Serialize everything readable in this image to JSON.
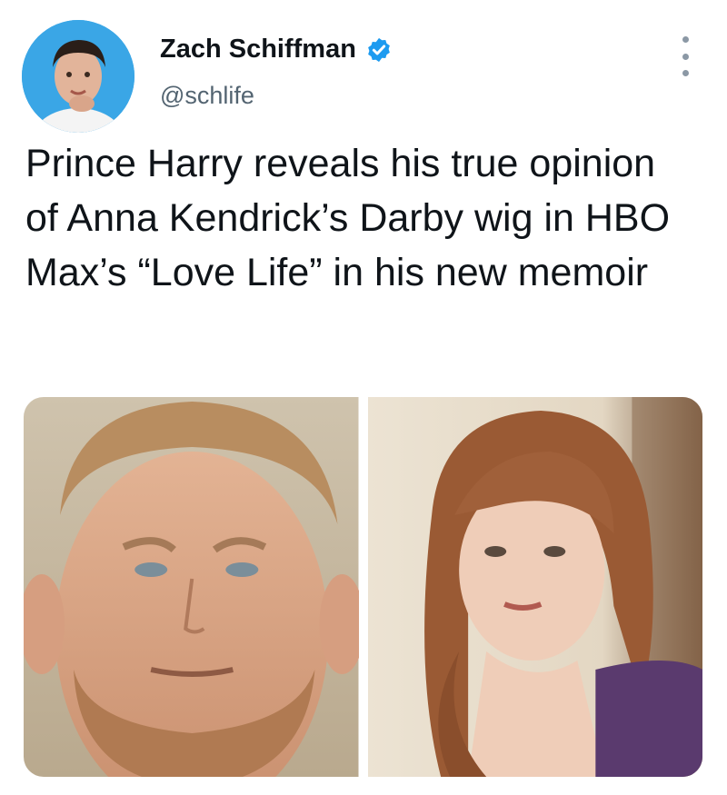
{
  "author": {
    "name": "Zach Schiffman",
    "handle": "@schlife",
    "avatar": "profile-photo",
    "verified_icon": "verified-badge-icon",
    "colors": {
      "verified": "#1d9bf0",
      "avatar_bg": "#3aa6e6"
    }
  },
  "menu": {
    "icon": "more-options-icon"
  },
  "tweet": {
    "text": "Prince Harry reveals his true opinion of Anna Kendrick’s Darby wig in HBO Max’s “Love Life” in his new memoir"
  },
  "media": [
    {
      "kind": "photo",
      "subject": "portrait-man"
    },
    {
      "kind": "photo",
      "subject": "portrait-woman"
    }
  ]
}
